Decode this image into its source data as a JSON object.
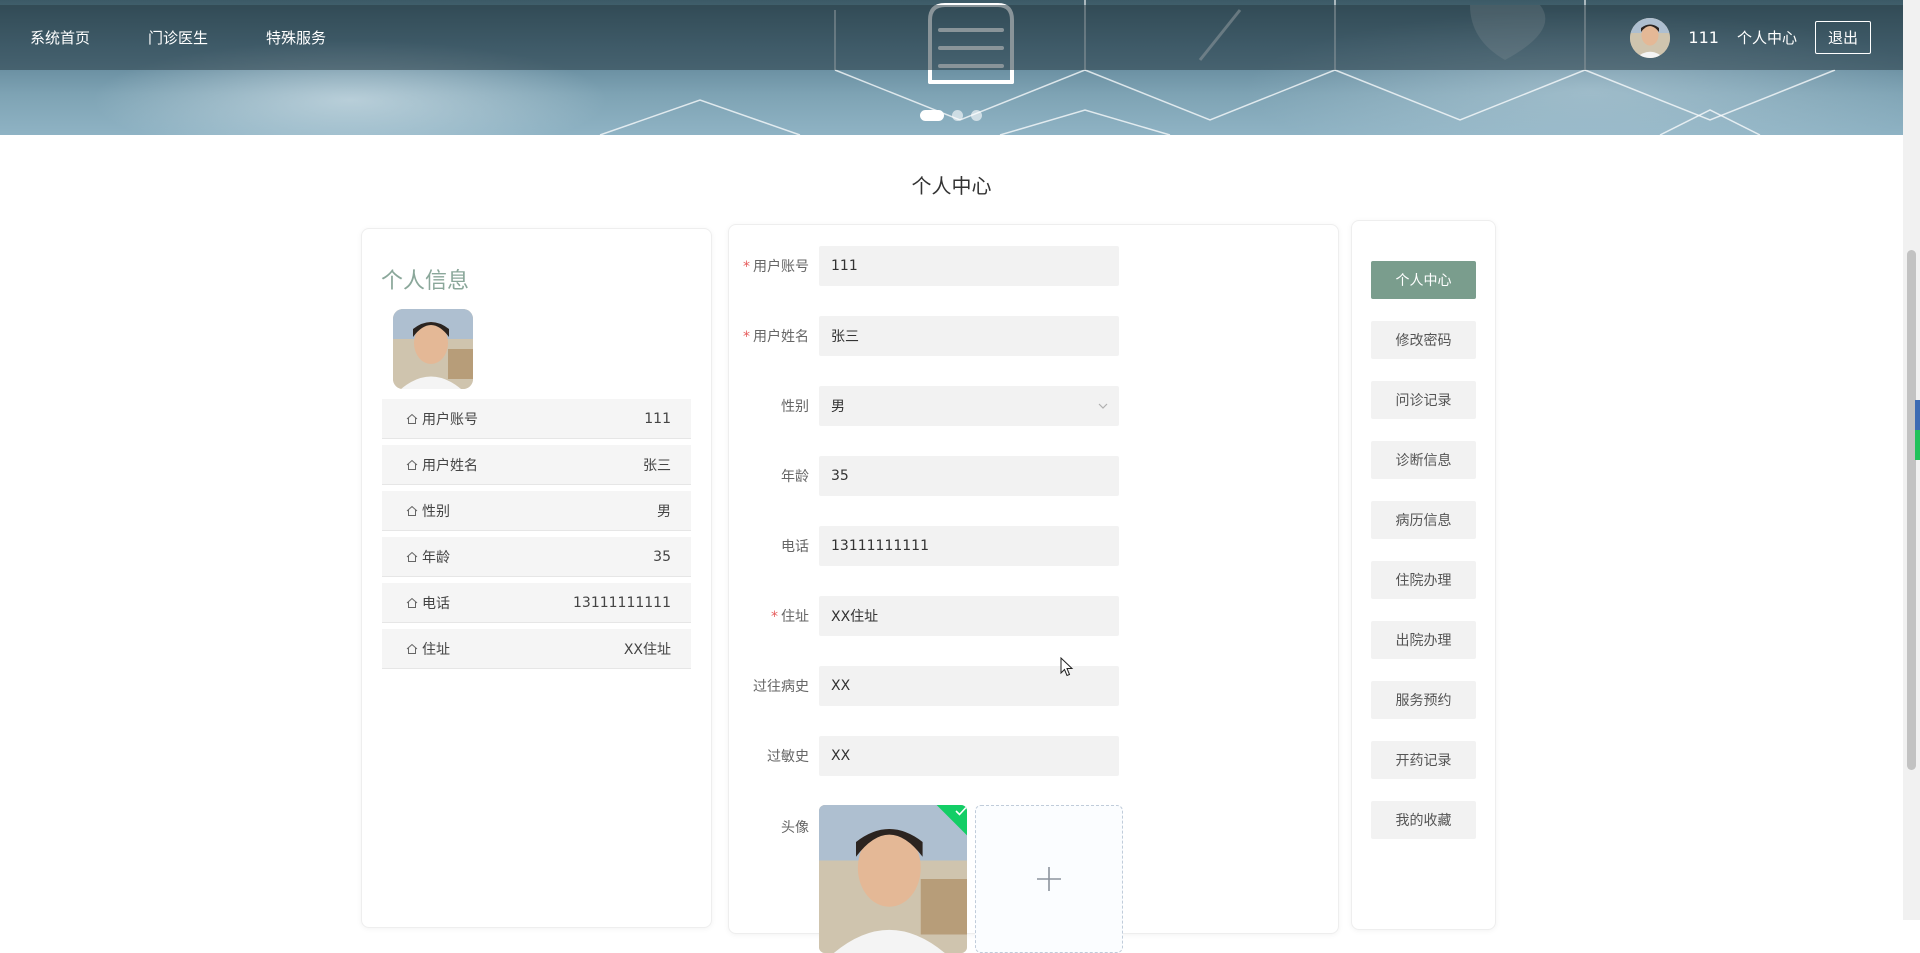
{
  "nav": {
    "items": [
      "系统首页",
      "门诊医生",
      "特殊服务"
    ],
    "username": "111",
    "center_label": "个人中心",
    "logout_label": "退出"
  },
  "page_title": "个人中心",
  "profile": {
    "title": "个人信息",
    "rows": [
      {
        "label": "用户账号",
        "value": "111"
      },
      {
        "label": "用户姓名",
        "value": "张三"
      },
      {
        "label": "性别",
        "value": "男"
      },
      {
        "label": "年龄",
        "value": "35"
      },
      {
        "label": "电话",
        "value": "13111111111"
      },
      {
        "label": "住址",
        "value": "XX住址"
      }
    ]
  },
  "form": {
    "required_mark": "*",
    "account": {
      "label": "用户账号",
      "value": "111"
    },
    "name": {
      "label": "用户姓名",
      "value": "张三"
    },
    "gender": {
      "label": "性别",
      "value": "男"
    },
    "age": {
      "label": "年龄",
      "value": "35"
    },
    "phone": {
      "label": "电话",
      "value": "13111111111"
    },
    "address": {
      "label": "住址",
      "value": "XX住址"
    },
    "history": {
      "label": "过往病史",
      "value": "XX"
    },
    "allergy": {
      "label": "过敏史",
      "value": "XX"
    },
    "avatar": {
      "label": "头像"
    }
  },
  "side_menu": {
    "items": [
      "个人中心",
      "修改密码",
      "问诊记录",
      "诊断信息",
      "病历信息",
      "住院办理",
      "出院办理",
      "服务预约",
      "开药记录",
      "我的收藏"
    ],
    "active_index": 0
  },
  "colors": {
    "accent": "#7a9d8d",
    "title_green": "#8aa79a",
    "required": "#e65b5b",
    "upload_success": "#13ce66"
  }
}
